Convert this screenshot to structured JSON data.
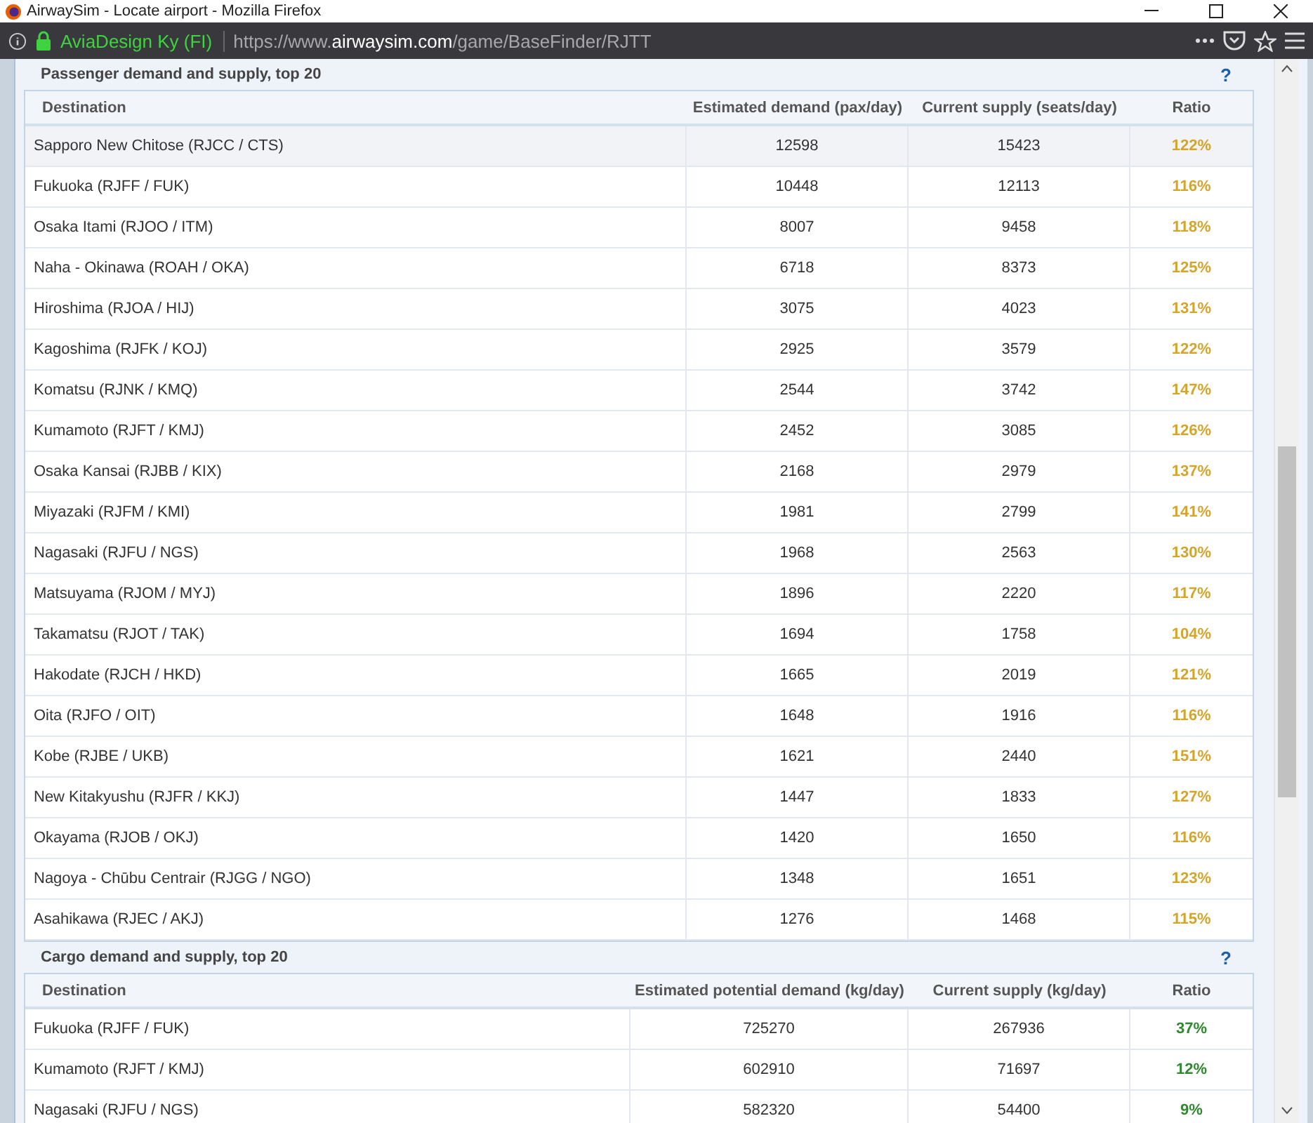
{
  "window": {
    "title": "AirwaySim - Locate airport - Mozilla Firefox"
  },
  "address_bar": {
    "identity": "AviaDesign Ky (FI)",
    "url": "https://www.**airwaysim.com**/game/BaseFinder/RJTT"
  },
  "sections": [
    {
      "kind": "passenger",
      "title": "Passenger demand and supply, top 20",
      "help": "?",
      "columns": [
        "Destination",
        "Estimated demand (pax/day)",
        "Current supply (seats/day)",
        "Ratio"
      ],
      "rows": [
        {
          "destination": "Sapporo New Chitose (RJCC / CTS)",
          "demand": "12598",
          "supply": "15423",
          "ratio": "122%",
          "selected": true
        },
        {
          "destination": "Fukuoka (RJFF / FUK)",
          "demand": "10448",
          "supply": "12113",
          "ratio": "116%",
          "selected": false
        },
        {
          "destination": "Osaka Itami (RJOO / ITM)",
          "demand": "8007",
          "supply": "9458",
          "ratio": "118%",
          "selected": false
        },
        {
          "destination": "Naha - Okinawa (ROAH / OKA)",
          "demand": "6718",
          "supply": "8373",
          "ratio": "125%",
          "selected": false
        },
        {
          "destination": "Hiroshima (RJOA / HIJ)",
          "demand": "3075",
          "supply": "4023",
          "ratio": "131%",
          "selected": false
        },
        {
          "destination": "Kagoshima (RJFK / KOJ)",
          "demand": "2925",
          "supply": "3579",
          "ratio": "122%",
          "selected": false
        },
        {
          "destination": "Komatsu (RJNK / KMQ)",
          "demand": "2544",
          "supply": "3742",
          "ratio": "147%",
          "selected": false
        },
        {
          "destination": "Kumamoto (RJFT / KMJ)",
          "demand": "2452",
          "supply": "3085",
          "ratio": "126%",
          "selected": false
        },
        {
          "destination": "Osaka Kansai (RJBB / KIX)",
          "demand": "2168",
          "supply": "2979",
          "ratio": "137%",
          "selected": false
        },
        {
          "destination": "Miyazaki (RJFM / KMI)",
          "demand": "1981",
          "supply": "2799",
          "ratio": "141%",
          "selected": false
        },
        {
          "destination": "Nagasaki (RJFU / NGS)",
          "demand": "1968",
          "supply": "2563",
          "ratio": "130%",
          "selected": false
        },
        {
          "destination": "Matsuyama (RJOM / MYJ)",
          "demand": "1896",
          "supply": "2220",
          "ratio": "117%",
          "selected": false
        },
        {
          "destination": "Takamatsu (RJOT / TAK)",
          "demand": "1694",
          "supply": "1758",
          "ratio": "104%",
          "selected": false
        },
        {
          "destination": "Hakodate (RJCH / HKD)",
          "demand": "1665",
          "supply": "2019",
          "ratio": "121%",
          "selected": false
        },
        {
          "destination": "Oita (RJFO / OIT)",
          "demand": "1648",
          "supply": "1916",
          "ratio": "116%",
          "selected": false
        },
        {
          "destination": "Kobe (RJBE / UKB)",
          "demand": "1621",
          "supply": "2440",
          "ratio": "151%",
          "selected": false
        },
        {
          "destination": "New Kitakyushu (RJFR / KKJ)",
          "demand": "1447",
          "supply": "1833",
          "ratio": "127%",
          "selected": false
        },
        {
          "destination": "Okayama (RJOB / OKJ)",
          "demand": "1420",
          "supply": "1650",
          "ratio": "116%",
          "selected": false
        },
        {
          "destination": "Nagoya - Chūbu Centrair (RJGG / NGO)",
          "demand": "1348",
          "supply": "1651",
          "ratio": "123%",
          "selected": false
        },
        {
          "destination": "Asahikawa (RJEC / AKJ)",
          "demand": "1276",
          "supply": "1468",
          "ratio": "115%",
          "selected": false
        }
      ]
    },
    {
      "kind": "cargo",
      "title": "Cargo demand and supply, top 20",
      "help": "?",
      "columns": [
        "Destination",
        "Estimated potential demand (kg/day)",
        "Current supply (kg/day)",
        "Ratio"
      ],
      "rows": [
        {
          "destination": "Fukuoka (RJFF / FUK)",
          "demand": "725270",
          "supply": "267936",
          "ratio": "37%",
          "selected": false
        },
        {
          "destination": "Kumamoto (RJFT / KMJ)",
          "demand": "602910",
          "supply": "71697",
          "ratio": "12%",
          "selected": false
        },
        {
          "destination": "Nagasaki (RJFU / NGS)",
          "demand": "582320",
          "supply": "54400",
          "ratio": "9%",
          "selected": false
        }
      ]
    }
  ]
}
